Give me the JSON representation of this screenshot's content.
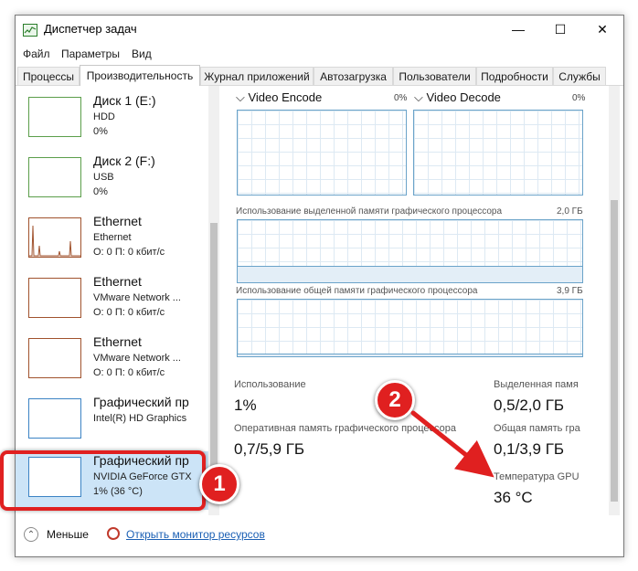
{
  "window": {
    "title": "Диспетчер задач",
    "controls": {
      "minimize": "—",
      "maximize": "☐",
      "close": "✕"
    }
  },
  "menu": {
    "file": "Файл",
    "options": "Параметры",
    "view": "Вид"
  },
  "tabs": [
    "Процессы",
    "Производительность",
    "Журнал приложений",
    "Автозагрузка",
    "Пользователи",
    "Подробности",
    "Службы"
  ],
  "devices": [
    {
      "title": "Диск 1 (E:)",
      "line2": "HDD",
      "line3": "0%"
    },
    {
      "title": "Диск 2 (F:)",
      "line2": "USB",
      "line3": "0%"
    },
    {
      "title": "Ethernet",
      "line2": "Ethernet",
      "line3": "О: 0 П: 0 кбит/с"
    },
    {
      "title": "Ethernet",
      "line2": "VMware Network ...",
      "line3": "О: 0 П: 0 кбит/с"
    },
    {
      "title": "Ethernet",
      "line2": "VMware Network ...",
      "line3": "О: 0 П: 0 кбит/с"
    },
    {
      "title": "Графический пр",
      "line2": "Intel(R) HD Graphics",
      "line3": ""
    },
    {
      "title": "Графический пр",
      "line2": "NVIDIA GeForce GTX",
      "line3": "1% (36 °C)"
    }
  ],
  "gpu": {
    "video_encode": {
      "label": "Video Encode",
      "pct": "0%"
    },
    "video_decode": {
      "label": "Video Decode",
      "pct": "0%"
    },
    "dedicated_mem": {
      "label": "Использование выделенной памяти графического процессора",
      "value": "2,0 ГБ",
      "fill_fraction": 0.25
    },
    "shared_mem": {
      "label": "Использование общей памяти графического процессора",
      "value": "3,9 ГБ",
      "fill_fraction": 0.03
    },
    "stats": {
      "usage_label": "Использование",
      "usage_value": "1%",
      "ded_label": "Выделенная памя",
      "ded_value": "0,5/2,0 ГБ",
      "op_label": "Оперативная память графического процессора",
      "op_value": "0,7/5,9 ГБ",
      "shared_label": "Общая память гра",
      "shared_value": "0,1/3,9 ГБ",
      "temp_label": "Температура GPU",
      "temp_value": "36 °C"
    }
  },
  "footer": {
    "less": "Меньше",
    "monitor": "Открыть монитор ресурсов"
  },
  "annotations": {
    "badge1": "1",
    "badge2": "2",
    "color": "#e02020"
  }
}
